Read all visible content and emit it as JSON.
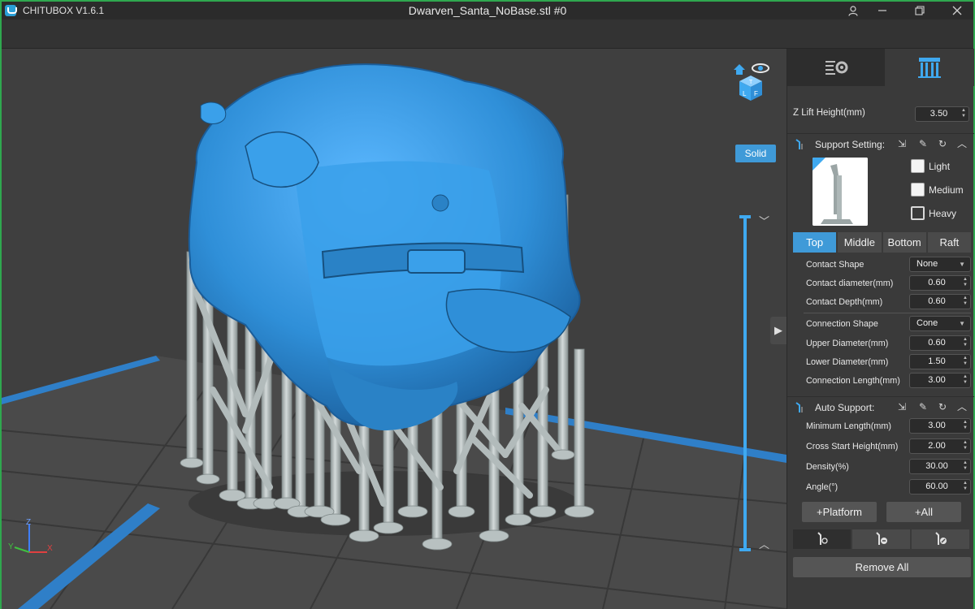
{
  "app": {
    "name": "CHITUBOX V1.6.1",
    "file_title": "Dwarven_Santa_NoBase.stl #0"
  },
  "viewport": {
    "render_mode_label": "Solid",
    "view_cube_faces": [
      "T",
      "L",
      "F"
    ],
    "axis_labels": {
      "x": "X",
      "y": "Y",
      "z": "Z"
    },
    "icons": [
      "home-icon",
      "eye-icon",
      "view-cube-icon",
      "chevron-down-icon",
      "chevron-up-icon",
      "chevron-right-icon"
    ]
  },
  "panel": {
    "tabs": [
      {
        "icon": "settings-list-icon",
        "active": false
      },
      {
        "icon": "support-pillars-icon",
        "active": true
      }
    ],
    "z_lift": {
      "label": "Z Lift Height(mm)",
      "value": "3.50"
    },
    "support_setting": {
      "title": "Support Setting:",
      "presets": [
        {
          "label": "Light",
          "checked": false
        },
        {
          "label": "Medium",
          "checked": false
        },
        {
          "label": "Heavy",
          "checked": true
        }
      ],
      "segments": [
        "Top",
        "Middle",
        "Bottom",
        "Raft"
      ],
      "active_segment": "Top",
      "rows": [
        {
          "label": "Contact Shape",
          "value": "None",
          "kind": "select"
        },
        {
          "label": "Contact diameter(mm)",
          "value": "0.60",
          "kind": "spin"
        },
        {
          "label": "Contact Depth(mm)",
          "value": "0.60",
          "kind": "spin"
        },
        {
          "label": "Connection Shape",
          "value": "Cone",
          "kind": "select"
        },
        {
          "label": "Upper Diameter(mm)",
          "value": "0.60",
          "kind": "spin"
        },
        {
          "label": "Lower Diameter(mm)",
          "value": "1.50",
          "kind": "spin"
        },
        {
          "label": "Connection Length(mm)",
          "value": "3.00",
          "kind": "spin"
        }
      ]
    },
    "auto_support": {
      "title": "Auto Support:",
      "rows": [
        {
          "label": "Minimum Length(mm)",
          "value": "3.00"
        },
        {
          "label": "Cross Start Height(mm)",
          "value": "2.00"
        },
        {
          "label": "Density(%)",
          "value": "30.00"
        },
        {
          "label": "Angle(°)",
          "value": "60.00"
        }
      ],
      "platform_button": "+Platform",
      "all_button": "+All"
    },
    "tool_buttons": [
      "add-support-icon",
      "delete-support-icon",
      "edit-support-icon"
    ],
    "remove_all": "Remove All"
  },
  "colors": {
    "model": "#2f8fd8",
    "supports": "#b4bdbd",
    "accent": "#3f9ad8",
    "frame": "#2fa84f",
    "grid_edge": "#2f7fc8"
  }
}
